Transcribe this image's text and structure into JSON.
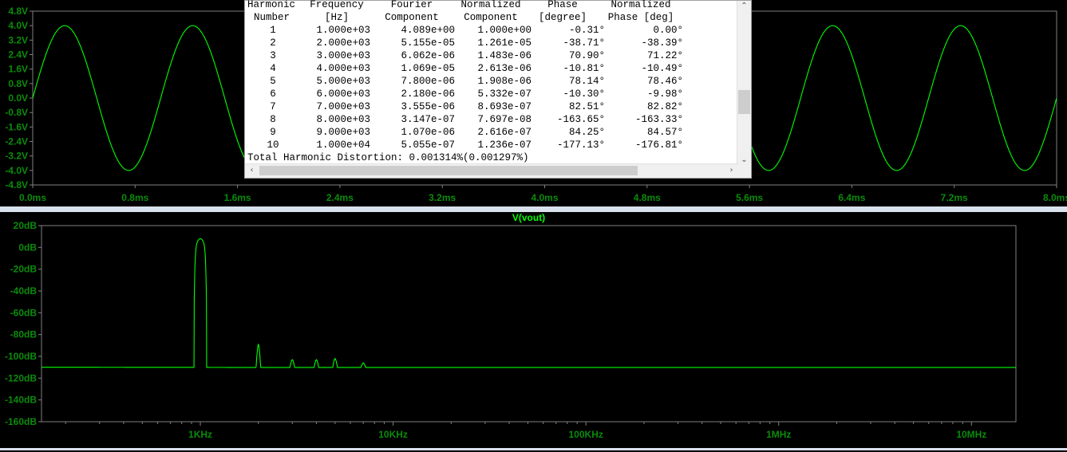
{
  "chart_data": [
    {
      "type": "line",
      "title": "",
      "xlabel": "",
      "ylabel": "",
      "x_unit": "ms",
      "xlim": [
        0,
        8
      ],
      "ylim": [
        -4.8,
        4.8
      ],
      "x_ticks": [
        "0.0ms",
        "0.8ms",
        "1.6ms",
        "2.4ms",
        "3.2ms",
        "4.0ms",
        "4.8ms",
        "5.6ms",
        "6.4ms",
        "7.2ms",
        "8.0ms"
      ],
      "y_ticks": [
        "4.8V",
        "4.0V",
        "3.2V",
        "2.4V",
        "1.6V",
        "0.8V",
        "0.0V",
        "-0.8V",
        "-1.6V",
        "-2.4V",
        "-3.2V",
        "-4.0V",
        "-4.8V"
      ],
      "series": [
        {
          "amplitude_v": 4.0,
          "frequency_hz": 1000,
          "color": "#00ff00"
        }
      ],
      "grid": false
    },
    {
      "type": "line",
      "title": "V(vout)",
      "xlabel": "",
      "ylabel": "",
      "x_scale": "log",
      "xlim_hz": [
        150,
        17000000
      ],
      "ylim": [
        -160,
        20
      ],
      "x_ticks": [
        {
          "hz": 1000,
          "label": "1KHz"
        },
        {
          "hz": 10000,
          "label": "10KHz"
        },
        {
          "hz": 100000,
          "label": "100KHz"
        },
        {
          "hz": 1000000,
          "label": "1MHz"
        },
        {
          "hz": 10000000,
          "label": "10MHz"
        }
      ],
      "y_ticks": [
        "20dB",
        "0dB",
        "-20dB",
        "-40dB",
        "-60dB",
        "-80dB",
        "-100dB",
        "-120dB",
        "-140dB",
        "-160dB"
      ],
      "series": [
        {
          "name": "V(vout)",
          "color": "#00ff00",
          "floor_db": -110,
          "peaks": [
            {
              "hz": 1000,
              "db": 8
            },
            {
              "hz": 2000,
              "db": -89
            },
            {
              "hz": 3000,
              "db": -103
            },
            {
              "hz": 4000,
              "db": -103
            },
            {
              "hz": 5000,
              "db": -102
            },
            {
              "hz": 7000,
              "db": -106
            }
          ],
          "rolloff": [
            {
              "hz": 150,
              "db": -110
            },
            {
              "hz": 150000,
              "db": -110.5
            },
            {
              "hz": 500000,
              "db": -114
            },
            {
              "hz": 1000000,
              "db": -120
            },
            {
              "hz": 3000000,
              "db": -131
            },
            {
              "hz": 10000000,
              "db": -141
            },
            {
              "hz": 17000000,
              "db": -144
            }
          ]
        }
      ],
      "grid": false
    }
  ],
  "fourier": {
    "headers_line1": [
      "Harmonic",
      "Frequency",
      "Fourier",
      "Normalized",
      "Phase",
      "Normalized"
    ],
    "headers_line2": [
      "Number",
      "[Hz]",
      "Component",
      "Component",
      "[degree]",
      "Phase [deg]"
    ],
    "rows": [
      [
        "1",
        "1.000e+03",
        "4.089e+00",
        "1.000e+00",
        "-0.31°",
        "0.00°"
      ],
      [
        "2",
        "2.000e+03",
        "5.155e-05",
        "1.261e-05",
        "-38.71°",
        "-38.39°"
      ],
      [
        "3",
        "3.000e+03",
        "6.062e-06",
        "1.483e-06",
        "70.90°",
        "71.22°"
      ],
      [
        "4",
        "4.000e+03",
        "1.069e-05",
        "2.613e-06",
        "-10.81°",
        "-10.49°"
      ],
      [
        "5",
        "5.000e+03",
        "7.800e-06",
        "1.908e-06",
        "78.14°",
        "78.46°"
      ],
      [
        "6",
        "6.000e+03",
        "2.180e-06",
        "5.332e-07",
        "-10.30°",
        "-9.98°"
      ],
      [
        "7",
        "7.000e+03",
        "3.555e-06",
        "8.693e-07",
        "82.51°",
        "82.82°"
      ],
      [
        "8",
        "8.000e+03",
        "3.147e-07",
        "7.697e-08",
        "-163.65°",
        "-163.33°"
      ],
      [
        "9",
        "9.000e+03",
        "1.070e-06",
        "2.616e-07",
        "84.25°",
        "84.57°"
      ],
      [
        "10",
        "1.000e+04",
        "5.055e-07",
        "1.236e-07",
        "-177.13°",
        "-176.81°"
      ]
    ],
    "thd": "Total Harmonic Distortion: 0.001314%(0.001297%)"
  },
  "colors": {
    "trace": "#00ff00",
    "background": "#000000",
    "frame": "#808080",
    "label": "#0a8c0a"
  }
}
